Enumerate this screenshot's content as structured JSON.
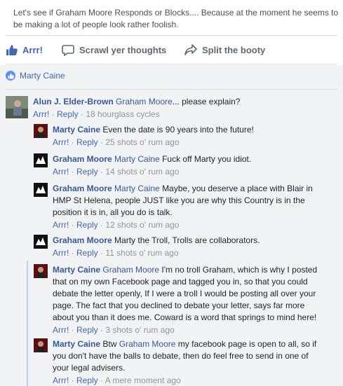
{
  "post": {
    "text": "Let's see if Graham Moore Responds or Blocks.... Because at the moment he seems to be making a lot of people look rather foolish."
  },
  "actions": {
    "like_label": "Arrr!",
    "comment_label": "Scrawl yer thoughts",
    "share_label": "Split the booty"
  },
  "reactions": {
    "name": "Marty Caine"
  },
  "comments": [
    {
      "author": "Alun J. Elder-Brown",
      "mention": "Graham Moore",
      "text": "... please explain?",
      "like": "Arrr!",
      "reply": "Reply",
      "time": "18 hourglass cycles"
    },
    {
      "author": "Marty Caine",
      "mention": "",
      "text": "Even the date is 90 years into the future!",
      "like": "Arrr!",
      "reply": "Reply",
      "time": "25 shots o' rum ago"
    },
    {
      "author": "Graham Moore",
      "mention": "Marty Caine",
      "text": "Fuck off Marty you idiot.",
      "like": "Arrr!",
      "reply": "Reply",
      "time": "14 shots o' rum ago"
    },
    {
      "author": "Graham Moore",
      "mention": "Marty Caine",
      "text": "Maybe, you deserve a place with Blair in HMP St Helena, people JUST like you are why this Country is in the position it is in, all you do is talk.",
      "like": "Arrr!",
      "reply": "Reply",
      "time": "12 shots o' rum ago"
    },
    {
      "author": "Graham Moore",
      "mention": "",
      "text": "Marty the Troll, Trolls are collaborators.",
      "like": "Arrr!",
      "reply": "Reply",
      "time": "11 shots o' rum ago"
    },
    {
      "author": "Marty Caine",
      "mention": "Graham Moore",
      "text": "I'm no troll Graham, which is why I posted that on my own Facebook page and tagged you in, so that you could debate the letter openly, If I were a troll I would be posting all over your page. The fact that you declined to debate your letter, says far more about you than it does me. Coward is a word that springs to mind here!",
      "like": "Arrr!",
      "reply": "Reply",
      "time": "3 shots o' rum ago"
    },
    {
      "author": "Marty Caine",
      "mention": "",
      "text": "Btw",
      "mention2": "Graham Moore",
      "text2": "my facebook page is open to all, so if you don't have the balls to debate, then do feel free to send in one of your legal advisers.",
      "like": "Arrr!",
      "reply": "Reply",
      "time": "A mere moment ago"
    }
  ],
  "colors": {
    "link": "#385898",
    "accent": "#4267b2",
    "meta": "#90949c",
    "comments_bg": "#f2f3f5"
  }
}
